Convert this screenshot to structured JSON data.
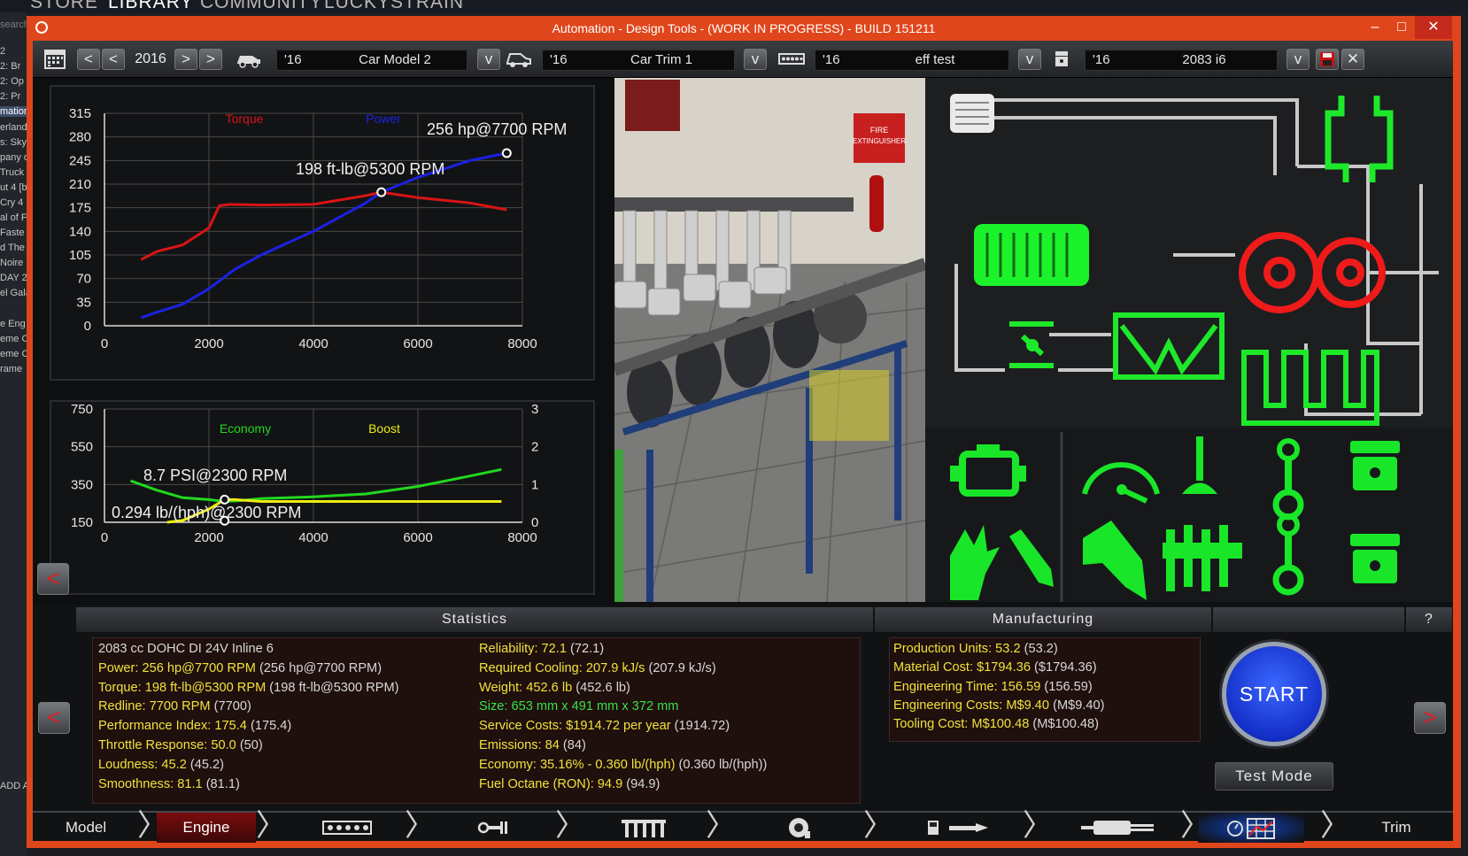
{
  "steam": {
    "nav_store": "STORE",
    "nav_library": "LIBRARY",
    "nav_community": "COMMUNITY",
    "nav_user": "LUCKYSTRAIN",
    "search": "search",
    "sidebar_items": [
      "2",
      "2: Br",
      "2: Op",
      "2: Pr",
      "mation",
      "erland",
      "s: Sky",
      "pany o",
      "Truck",
      "ut 4 [b",
      "Cry 4",
      "al of F",
      "Faste",
      "d The",
      "Noire",
      "DAY 2",
      "el Gala",
      "e Eng",
      "eme C",
      "eme C",
      "rame"
    ],
    "add_game": "ADD A"
  },
  "window": {
    "title": "Automation - Design Tools - (WORK IN PROGRESS) - BUILD 151211",
    "minimize": "–",
    "maximize": "□",
    "close": "✕"
  },
  "toolbar": {
    "year": "2016",
    "model_year": "'16",
    "model_name": "Car Model 2",
    "trim_year": "'16",
    "trim_name": "Car Trim 1",
    "engine_year": "'16",
    "engine_name": "eff test",
    "variant_year": "'16",
    "variant_name": "2083 i6",
    "dropdown": "v",
    "prev": "<",
    "next": ">",
    "close": "✕"
  },
  "power_chart": {
    "type": "line",
    "legend": [
      "Torque",
      "Power"
    ],
    "xticks": [
      "0",
      "2000",
      "4000",
      "6000",
      "8000"
    ],
    "yticks": [
      "0",
      "35",
      "70",
      "105",
      "140",
      "175",
      "210",
      "245",
      "280",
      "315"
    ],
    "xlim": [
      0,
      8000
    ],
    "ylim": [
      0,
      315
    ],
    "peak_power_label": "256 hp@7700 RPM",
    "peak_torque_label": "198 ft-lb@5300 RPM",
    "colors": {
      "torque": "#d81414",
      "power": "#1a22e0"
    },
    "series": [
      {
        "name": "Torque",
        "x": [
          700,
          1000,
          1500,
          2000,
          2200,
          2400,
          3000,
          4000,
          5000,
          5300,
          6000,
          7000,
          7700
        ],
        "y": [
          98,
          110,
          120,
          145,
          178,
          180,
          179,
          180,
          193,
          198,
          190,
          182,
          172
        ]
      },
      {
        "name": "Power",
        "x": [
          700,
          1000,
          1500,
          2000,
          2500,
          3000,
          4000,
          5000,
          5300,
          6000,
          7000,
          7700
        ],
        "y": [
          12,
          20,
          32,
          55,
          84,
          105,
          140,
          182,
          198,
          220,
          245,
          256
        ]
      }
    ],
    "peaks": [
      {
        "x": 7700,
        "y": 256
      },
      {
        "x": 5300,
        "y": 198
      }
    ]
  },
  "econ_chart": {
    "type": "line",
    "legend": [
      "Economy",
      "Boost"
    ],
    "xticks": [
      "0",
      "2000",
      "4000",
      "6000",
      "8000"
    ],
    "yticks_left": [
      "150",
      "350",
      "550",
      "750"
    ],
    "yticks_right": [
      "0",
      "1",
      "2",
      "3"
    ],
    "xlim": [
      0,
      8000
    ],
    "ylim_left": [
      150,
      750
    ],
    "ylim_right": [
      0,
      3
    ],
    "boost_label": "8.7 PSI@2300 RPM",
    "econ_label": "0.294 lb/(hph)@2300 RPM",
    "colors": {
      "economy": "#22d81e",
      "boost": "#ecec12"
    },
    "series": [
      {
        "name": "Economy",
        "x": [
          500,
          1000,
          1500,
          2000,
          2300,
          2600,
          3000,
          4000,
          5000,
          6000,
          7000,
          7600
        ],
        "y": [
          370,
          320,
          280,
          270,
          260,
          265,
          275,
          285,
          300,
          340,
          395,
          430
        ]
      },
      {
        "name": "Boost",
        "x": [
          1200,
          1500,
          2000,
          2300,
          2500,
          3000,
          4000,
          5000,
          6000,
          7600
        ],
        "y": [
          0,
          0.05,
          0.35,
          0.6,
          0.6,
          0.55,
          0.55,
          0.55,
          0.55,
          0.55
        ]
      }
    ],
    "markers": [
      {
        "x": 2300,
        "y": 0.6,
        "axis": "right"
      },
      {
        "x": 2300,
        "y": 158,
        "axis": "left"
      }
    ]
  },
  "stats": {
    "header": "Statistics",
    "left": [
      {
        "text": "2083 cc DOHC DI 24V Inline 6",
        "color": "white"
      },
      {
        "text": "Power: 256 hp@7700 RPM",
        "extra": " (256 hp@7700 RPM)",
        "color": "yellow"
      },
      {
        "text": "Torque: 198 ft-lb@5300 RPM",
        "extra": " (198 ft-lb@5300 RPM)",
        "color": "yellow"
      },
      {
        "text": "Redline: 7700 RPM",
        "extra": " (7700)",
        "color": "yellow"
      },
      {
        "text": "Performance Index: 175.4",
        "extra": " (175.4)",
        "color": "yellow"
      },
      {
        "text": "Throttle Response: 50.0",
        "extra": " (50)",
        "color": "yellow"
      },
      {
        "text": "Loudness: 45.2",
        "extra": " (45.2)",
        "color": "yellow"
      },
      {
        "text": "Smoothness: 81.1",
        "extra": " (81.1)",
        "color": "yellow"
      }
    ],
    "right": [
      {
        "text": "Reliability: 72.1",
        "extra": " (72.1)",
        "color": "yellow"
      },
      {
        "text": "Required Cooling: 207.9 kJ/s",
        "extra": " (207.9 kJ/s)",
        "color": "yellow"
      },
      {
        "text": "Weight: 452.6 lb",
        "extra": " (452.6 lb)",
        "color": "yellow"
      },
      {
        "text": "Size: 653 mm x 491 mm x 372 mm",
        "extra": "",
        "color": "green"
      },
      {
        "text": "Service Costs: $1914.72 per year",
        "extra": " (1914.72)",
        "color": "yellow"
      },
      {
        "text": "Emissions: 84",
        "extra": " (84)",
        "color": "yellow"
      },
      {
        "text": "Economy: 35.16% - 0.360 lb/(hph)",
        "extra": " (0.360 lb/(hph))",
        "color": "yellow"
      },
      {
        "text": "Fuel Octane (RON): 94.9",
        "extra": " (94.9)",
        "color": "yellow"
      }
    ]
  },
  "manufacturing": {
    "header": "Manufacturing",
    "help": "?",
    "items": [
      {
        "text": "Production Units: 53.2",
        "extra": " (53.2)"
      },
      {
        "text": "Material Cost: $1794.36",
        "extra": " ($1794.36)"
      },
      {
        "text": "Engineering Time: 156.59",
        "extra": " (156.59)"
      },
      {
        "text": "Engineering Costs: M$9.40",
        "extra": " (M$9.40)"
      },
      {
        "text": "Tooling Cost: M$100.48",
        "extra": " (M$100.48)"
      }
    ]
  },
  "actions": {
    "start": "START",
    "test_mode": "Test Mode",
    "back": "<",
    "forward": ">"
  },
  "scene": {
    "sign": "FIRE EXTINGUISHER"
  },
  "nav": {
    "model": "Model",
    "engine": "Engine",
    "trim": "Trim",
    "chevron": "〉"
  }
}
